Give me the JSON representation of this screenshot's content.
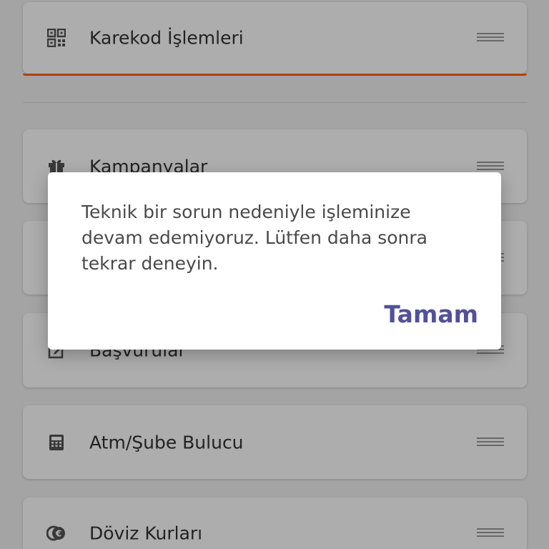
{
  "menu": {
    "items": [
      {
        "label": "Karekod İşlemleri",
        "icon": "qr-code-icon"
      },
      {
        "label": "Kampanyalar",
        "icon": "gift-icon"
      },
      {
        "label": "",
        "icon": ""
      },
      {
        "label": "Başvurular",
        "icon": "edit-icon"
      },
      {
        "label": "Atm/Şube Bulucu",
        "icon": "calculator-icon"
      },
      {
        "label": "Döviz Kurları",
        "icon": "currency-icon"
      }
    ]
  },
  "dialog": {
    "message": "Teknik bir sorun nedeniyle işleminize devam edemiyoruz. Lütfen daha sonra tekrar deneyin.",
    "button_label": "Tamam"
  },
  "colors": {
    "accent": "#ff6200",
    "dialog_button": "#525199"
  }
}
